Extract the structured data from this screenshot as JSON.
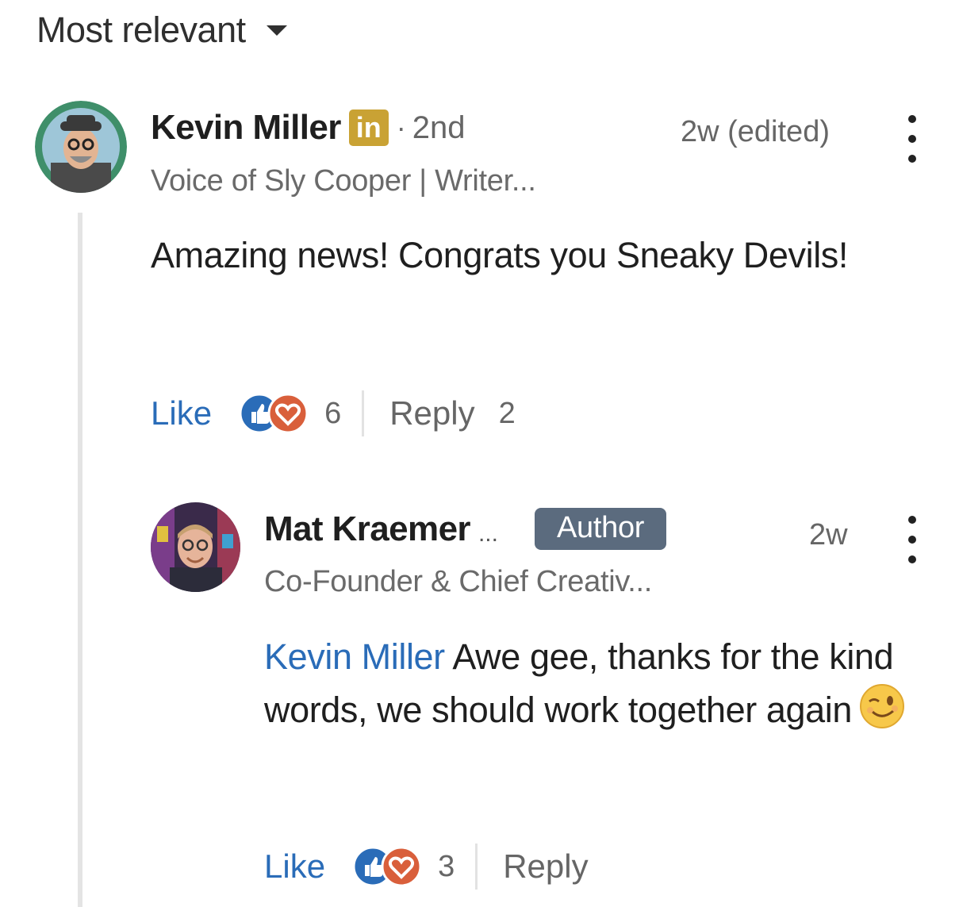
{
  "sort": {
    "label": "Most relevant",
    "icon": "caret-down-icon"
  },
  "comments": [
    {
      "author": "Kevin Miller",
      "linkedin_badge": "in",
      "separator": "·",
      "degree": "2nd",
      "headline": "Voice of Sly Cooper | Writer...",
      "timestamp": "2w (edited)",
      "body": "Amazing news! Congrats you Sneaky Devils!",
      "like_label": "Like",
      "reaction_count": "6",
      "reply_label": "Reply",
      "reply_count": "2"
    },
    {
      "author": "Mat Kraemer",
      "author_truncation": "...",
      "badge": "Author",
      "headline": "Co-Founder & Chief Creativ...",
      "timestamp": "2w",
      "mention": "Kevin Miller",
      "body": " Awe gee, thanks for the kind words, we should work together again",
      "emoji": "winking-face",
      "like_label": "Like",
      "reaction_count": "3",
      "reply_label": "Reply"
    }
  ],
  "colors": {
    "link_blue": "#2a6cb8",
    "linkedin_badge": "#c9a234",
    "author_badge": "#5b6b7e",
    "like_reaction": "#2a6cb8",
    "love_reaction": "#d95f3b"
  }
}
